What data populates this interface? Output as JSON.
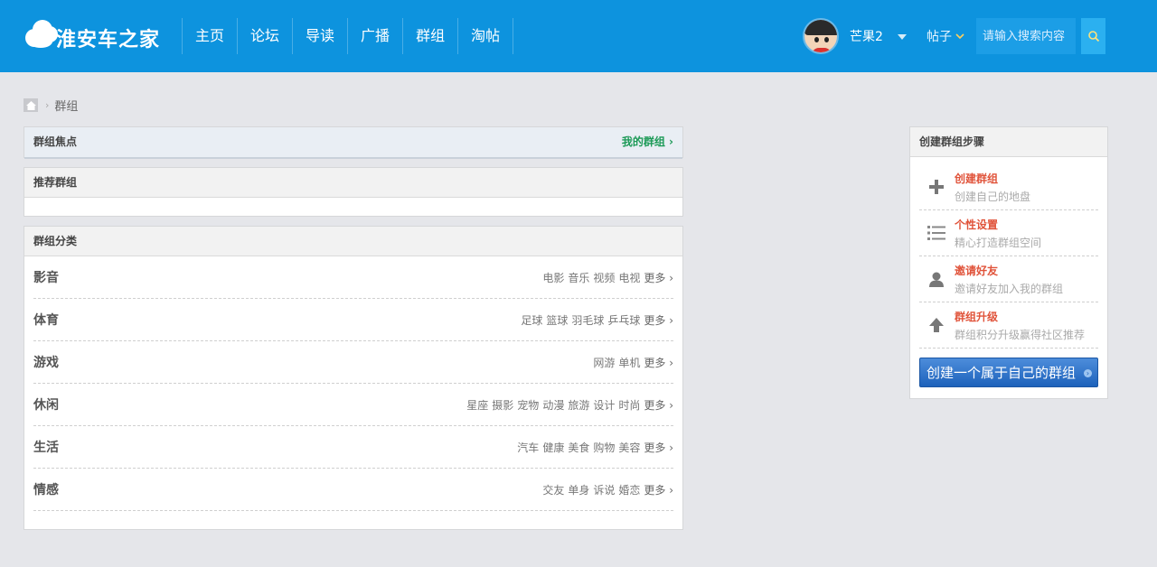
{
  "header": {
    "logo_text": "淮安车之家",
    "nav": [
      "主页",
      "论坛",
      "导读",
      "广播",
      "群组",
      "淘帖"
    ],
    "username": "芒果2",
    "search_scope": "帖子",
    "search_placeholder": "请输入搜索内容"
  },
  "breadcrumb": {
    "current": "群组"
  },
  "focus": {
    "title": "群组焦点",
    "my_groups": "我的群组 ›"
  },
  "recommend": {
    "title": "推荐群组"
  },
  "categories": {
    "title": "群组分类",
    "more": "更多 ›",
    "rows": [
      {
        "name": "影音",
        "links": [
          "电影",
          "音乐",
          "视频",
          "电视"
        ]
      },
      {
        "name": "体育",
        "links": [
          "足球",
          "篮球",
          "羽毛球",
          "乒乓球"
        ]
      },
      {
        "name": "游戏",
        "links": [
          "网游",
          "单机"
        ]
      },
      {
        "name": "休闲",
        "links": [
          "星座",
          "摄影",
          "宠物",
          "动漫",
          "旅游",
          "设计",
          "时尚"
        ]
      },
      {
        "name": "生活",
        "links": [
          "汽车",
          "健康",
          "美食",
          "购物",
          "美容"
        ]
      },
      {
        "name": "情感",
        "links": [
          "交友",
          "单身",
          "诉说",
          "婚恋"
        ]
      }
    ]
  },
  "steps": {
    "title": "创建群组步骤",
    "items": [
      {
        "title": "创建群组",
        "desc": "创建自己的地盘",
        "icon": "plus-icon"
      },
      {
        "title": "个性设置",
        "desc": "精心打造群组空间",
        "icon": "list-icon"
      },
      {
        "title": "邀请好友",
        "desc": "邀请好友加入我的群组",
        "icon": "user-icon"
      },
      {
        "title": "群组升级",
        "desc": "群组积分升级赢得社区推荐",
        "icon": "arrow-up-icon"
      }
    ],
    "create_button": "创建一个属于自己的群组"
  },
  "colors": {
    "header_bg": "#0d93de",
    "accent_green": "#1c9a57",
    "step_title": "#e0533a",
    "button_blue": "#1d62bb"
  }
}
